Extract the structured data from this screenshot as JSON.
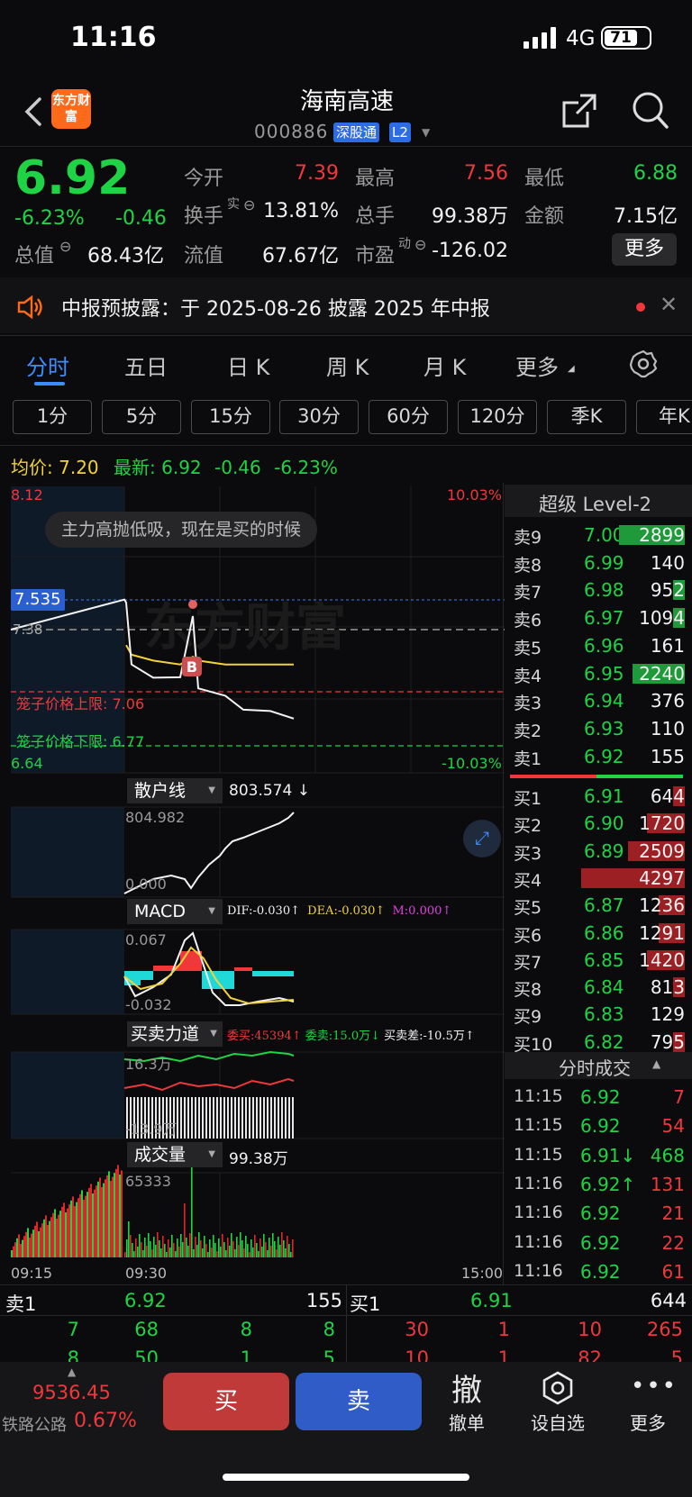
{
  "status": {
    "time": "11:16",
    "network": "4G",
    "battery": "71"
  },
  "header": {
    "logo_text": "东方财富",
    "stock_name": "海南高速",
    "stock_code": "000886",
    "tag_szt": "深股通",
    "tag_l2": "L2"
  },
  "quote": {
    "price": "6.92",
    "pct": "-6.23%",
    "change": "-0.46",
    "open_label": "今开",
    "open": "7.39",
    "high_label": "最高",
    "high": "7.56",
    "low_label": "最低",
    "low": "6.88",
    "turnover_label": "换手",
    "turnover_sup": "实",
    "turnover": "13.81%",
    "volume_label": "总手",
    "volume": "99.38万",
    "amount_label": "金额",
    "amount": "7.15亿",
    "mktcap_label": "总值",
    "mktcap": "68.43亿",
    "float_label": "流值",
    "float": "67.67亿",
    "pe_label": "市盈",
    "pe_sup": "动",
    "pe": "-126.02",
    "more": "更多"
  },
  "notice": {
    "text": "中报预披露：于 2025-08-26 披露 2025 年中报"
  },
  "tabs": [
    "分时",
    "五日",
    "日 K",
    "周 K",
    "月 K",
    "更多"
  ],
  "minute_buttons": [
    "1分",
    "5分",
    "15分",
    "30分",
    "60分",
    "120分",
    "季K",
    "年K"
  ],
  "info": {
    "avg_label": "均价:",
    "avg": "7.20",
    "latest_label": "最新:",
    "latest": "6.92",
    "change": "-0.46",
    "pct": "-6.23%"
  },
  "main_chart": {
    "y_top": "8.12",
    "y_top_pct": "10.03%",
    "y_bottom": "6.64",
    "y_bottom_pct": "-10.03%",
    "marker_price": "7.535",
    "prev_close": "7.38",
    "cage_upper_label": "笼子价格上限:",
    "cage_upper": "7.06",
    "cage_lower_label": "笼子价格下限:",
    "cage_lower": "6.77",
    "bubble": "主力高抛低吸，现在是买的时候",
    "buy_marker": "B",
    "watermark": "东方财富"
  },
  "retail": {
    "label": "散户线",
    "value": "803.574 ↓",
    "top": "804.982",
    "bottom": "0.000"
  },
  "macd": {
    "label": "MACD",
    "dif": "DIF:-0.030↑",
    "dea": "DEA:-0.030↑",
    "m": "M:0.000↑",
    "top": "0.067",
    "bottom": "-0.032"
  },
  "force": {
    "label": "买卖力道",
    "wei_buy": "委买:45394↑",
    "wei_sell": "委卖:15.0万↓",
    "diff": "买卖差:-10.5万↑",
    "top": "16.3万",
    "bottom": "-13.9万"
  },
  "vol": {
    "label": "成交量",
    "value": "99.38万",
    "top": "65333"
  },
  "time_axis": [
    "09:15",
    "09:30",
    "15:00"
  ],
  "orderbook": {
    "title": "超级 Level-2",
    "asks": [
      {
        "label": "卖9",
        "price": "7.00",
        "vol": "2899",
        "bar": 0.38
      },
      {
        "label": "卖8",
        "price": "6.99",
        "vol": "140",
        "bar": 0
      },
      {
        "label": "卖7",
        "price": "6.98",
        "vol": "952",
        "bar": 0.07
      },
      {
        "label": "卖6",
        "price": "6.97",
        "vol": "1094",
        "bar": 0.07
      },
      {
        "label": "卖5",
        "price": "6.96",
        "vol": "161",
        "bar": 0
      },
      {
        "label": "卖4",
        "price": "6.95",
        "vol": "2240",
        "bar": 0.3
      },
      {
        "label": "卖3",
        "price": "6.94",
        "vol": "376",
        "bar": 0
      },
      {
        "label": "卖2",
        "price": "6.93",
        "vol": "110",
        "bar": 0
      },
      {
        "label": "卖1",
        "price": "6.92",
        "vol": "155",
        "bar": 0
      }
    ],
    "bids": [
      {
        "label": "买1",
        "price": "6.91",
        "vol": "644",
        "bar": 0.07
      },
      {
        "label": "买2",
        "price": "6.90",
        "vol": "1720",
        "bar": 0.22
      },
      {
        "label": "买3",
        "price": "6.89",
        "vol": "2509",
        "bar": 0.33
      },
      {
        "label": "买4",
        "price": "6.88",
        "vol": "4297",
        "bar": 0.6
      },
      {
        "label": "买5",
        "price": "6.87",
        "vol": "1236",
        "bar": 0.15
      },
      {
        "label": "买6",
        "price": "6.86",
        "vol": "1291",
        "bar": 0.15
      },
      {
        "label": "买7",
        "price": "6.85",
        "vol": "1420",
        "bar": 0.22
      },
      {
        "label": "买8",
        "price": "6.84",
        "vol": "813",
        "bar": 0.07
      },
      {
        "label": "买9",
        "price": "6.83",
        "vol": "129",
        "bar": 0
      },
      {
        "label": "买10",
        "price": "6.82",
        "vol": "795",
        "bar": 0.07
      }
    ],
    "trades_title": "分时成交",
    "trades": [
      {
        "time": "11:15",
        "price": "6.92",
        "vol": "7",
        "color": "red"
      },
      {
        "time": "11:15",
        "price": "6.92",
        "vol": "54",
        "color": "red"
      },
      {
        "time": "11:15",
        "price": "6.91↓",
        "vol": "468",
        "color": "green"
      },
      {
        "time": "11:16",
        "price": "6.92↑",
        "vol": "131",
        "color": "red"
      },
      {
        "time": "11:16",
        "price": "6.92",
        "vol": "21",
        "color": "red"
      },
      {
        "time": "11:16",
        "price": "6.92",
        "vol": "22",
        "color": "red"
      },
      {
        "time": "11:16",
        "price": "6.92",
        "vol": "61",
        "color": "red"
      }
    ]
  },
  "bottom_quote": {
    "sell1_label": "卖1",
    "sell1_price": "6.92",
    "sell1_vol": "155",
    "buy1_label": "买1",
    "buy1_price": "6.91",
    "buy1_vol": "644",
    "row1_left": [
      "7",
      "68",
      "8",
      "8"
    ],
    "row1_right": [
      "30",
      "1",
      "10",
      "265"
    ],
    "row2_left": [
      "8",
      "50",
      "1",
      "5"
    ],
    "row2_right": [
      "10",
      "1",
      "82",
      "5"
    ]
  },
  "bottombar": {
    "index_value": "9536.45",
    "index_name": "铁路公路",
    "index_pct": "0.67%",
    "buy": "买",
    "sell": "卖",
    "cancel_char": "撤",
    "cancel": "撤单",
    "watchlist": "设自选",
    "more": "更多"
  },
  "colors": {
    "up": "#f0383c",
    "down": "#1ed445",
    "accent": "#3d8dff",
    "avg_line": "#f2d23a"
  },
  "chart_data": {
    "type": "line",
    "title": "海南高速",
    "x": [
      "09:15",
      "09:30",
      "15:00"
    ],
    "series": [
      {
        "name": "最新",
        "values": [
          7.38,
          7.535,
          7.52,
          7.2,
          7.15,
          7.12,
          7.45,
          7.1,
          7.02,
          6.98,
          6.95,
          6.92
        ]
      },
      {
        "name": "均价",
        "values": [
          7.38,
          7.535,
          7.3,
          7.25,
          7.22,
          7.2,
          7.24,
          7.22,
          7.2,
          7.2,
          7.2,
          7.2
        ]
      }
    ],
    "ylim": [
      6.64,
      8.12
    ],
    "xlabel": "",
    "ylabel": ""
  }
}
